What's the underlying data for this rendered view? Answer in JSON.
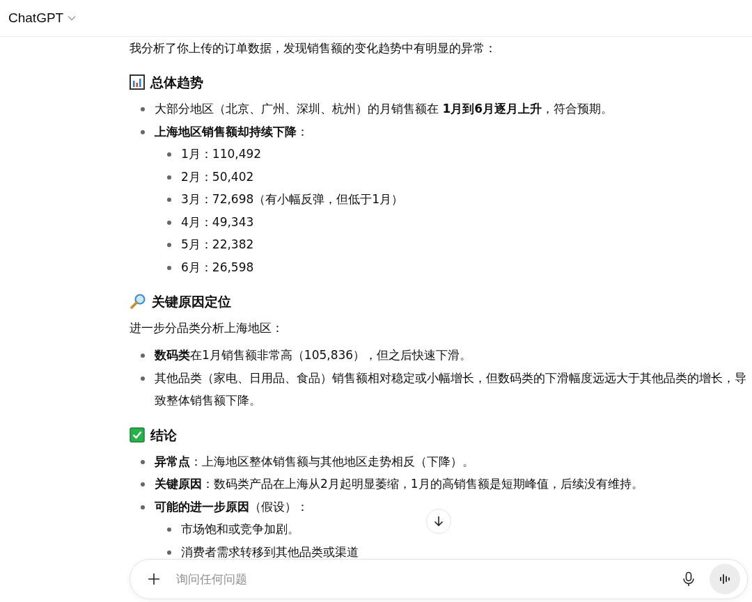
{
  "header": {
    "title": "ChatGPT"
  },
  "message": {
    "intro": "我分析了你上传的订单数据，发现销售额的变化趋势中有明显的异常：",
    "sections": [
      {
        "heading": "总体趋势",
        "blocks": [
          {
            "kind": "list",
            "items": [
              {
                "text": "大部分地区（北京、广州、深圳、杭州）的月销售额在 **1月到6月逐月上升**，符合预期。"
              },
              {
                "text": "**上海地区销售额却持续下降**：",
                "children": [
                  {
                    "text": "1月：110,492"
                  },
                  {
                    "text": "2月：50,402"
                  },
                  {
                    "text": "3月：72,698（有小幅反弹，但低于1月）"
                  },
                  {
                    "text": "4月：49,343"
                  },
                  {
                    "text": "5月：22,382"
                  },
                  {
                    "text": "6月：26,598"
                  }
                ]
              }
            ]
          }
        ]
      },
      {
        "heading": "关键原因定位",
        "blocks": [
          {
            "kind": "paragraph",
            "text": "进一步分品类分析上海地区："
          },
          {
            "kind": "list",
            "items": [
              {
                "text": "**数码类**在1月销售额非常高（105,836），但之后快速下滑。"
              },
              {
                "text": "其他品类（家电、日用品、食品）销售额相对稳定或小幅增长，但数码类的下滑幅度远远大于其他品类的增长，导致整体销售额下降。"
              }
            ]
          }
        ]
      },
      {
        "heading": "结论",
        "blocks": [
          {
            "kind": "list",
            "items": [
              {
                "text": "**异常点**：上海地区整体销售额与其他地区走势相反（下降）。"
              },
              {
                "text": "**关键原因**：数码类产品在上海从2月起明显萎缩，1月的高销售额是短期峰值，后续没有维持。"
              },
              {
                "text": "**可能的进一步原因**（假设）：",
                "children": [
                  {
                    "text": "市场饱和或竞争加剧。"
                  },
                  {
                    "text": "消费者需求转移到其他品类或渠道"
                  }
                ]
              }
            ]
          }
        ]
      }
    ]
  },
  "composer": {
    "placeholder": "询问任何问题"
  }
}
